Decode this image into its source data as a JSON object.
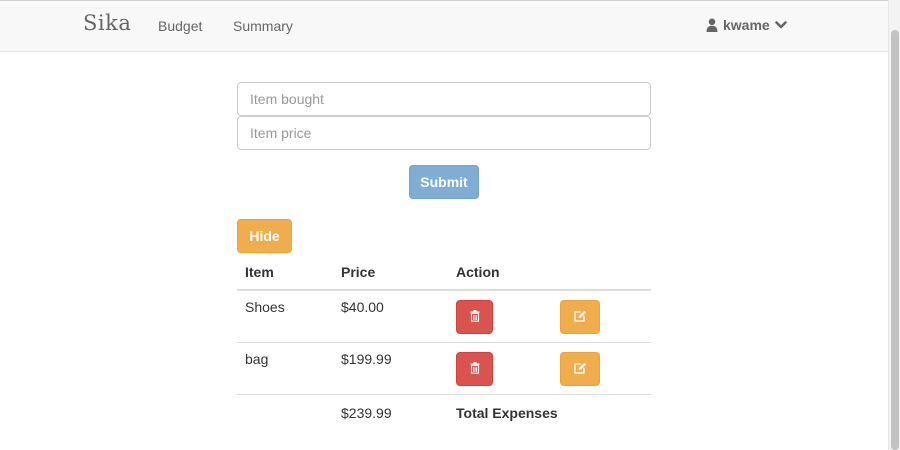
{
  "navbar": {
    "brand": "Sika",
    "links": [
      {
        "label": "Budget"
      },
      {
        "label": "Summary"
      }
    ],
    "user": {
      "name": "kwame"
    }
  },
  "form": {
    "item_placeholder": "Item bought",
    "price_placeholder": "Item price",
    "submit_label": "Submit"
  },
  "hide_label": "Hide",
  "table": {
    "headers": [
      "Item",
      "Price",
      "Action"
    ],
    "rows": [
      {
        "item": "Shoes",
        "price": "$40.00"
      },
      {
        "item": "bag",
        "price": "$199.99"
      }
    ],
    "total": {
      "price": "$239.99",
      "label": "Total Expenses"
    }
  },
  "colors": {
    "submit": "#7fadd3",
    "warning": "#f0ad4e",
    "danger": "#d9534f"
  },
  "icons": {
    "user": "user-icon",
    "caret": "chevron-down-icon",
    "delete": "trash-icon",
    "edit": "edit-icon"
  }
}
